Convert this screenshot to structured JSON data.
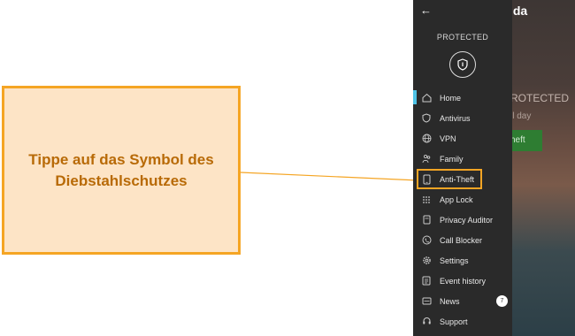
{
  "callout": {
    "text": "Tippe auf das Symbol des Diebstahlschutzes"
  },
  "app": {
    "brand": "panda",
    "status_label": "PROTECTED",
    "background_status": "ROTECTED",
    "background_subtext": "ll day",
    "background_button": "heft"
  },
  "menu": {
    "items": [
      {
        "label": "Home",
        "icon": "home-icon"
      },
      {
        "label": "Antivirus",
        "icon": "shield-icon"
      },
      {
        "label": "VPN",
        "icon": "globe-icon"
      },
      {
        "label": "Family",
        "icon": "family-icon"
      },
      {
        "label": "Anti-Theft",
        "icon": "phone-icon"
      },
      {
        "label": "App Lock",
        "icon": "keypad-icon"
      },
      {
        "label": "Privacy Auditor",
        "icon": "document-icon"
      },
      {
        "label": "Call Blocker",
        "icon": "call-icon"
      },
      {
        "label": "Settings",
        "icon": "gear-icon"
      },
      {
        "label": "Event history",
        "icon": "list-icon"
      },
      {
        "label": "News",
        "icon": "news-icon",
        "badge": "7"
      },
      {
        "label": "Support",
        "icon": "support-icon"
      }
    ]
  },
  "colors": {
    "callout_fill": "#fde4c6",
    "callout_border": "#f5a524",
    "callout_text": "#b86a07",
    "drawer_bg": "#2a2a2a",
    "active_accent": "#4fc3e6"
  }
}
